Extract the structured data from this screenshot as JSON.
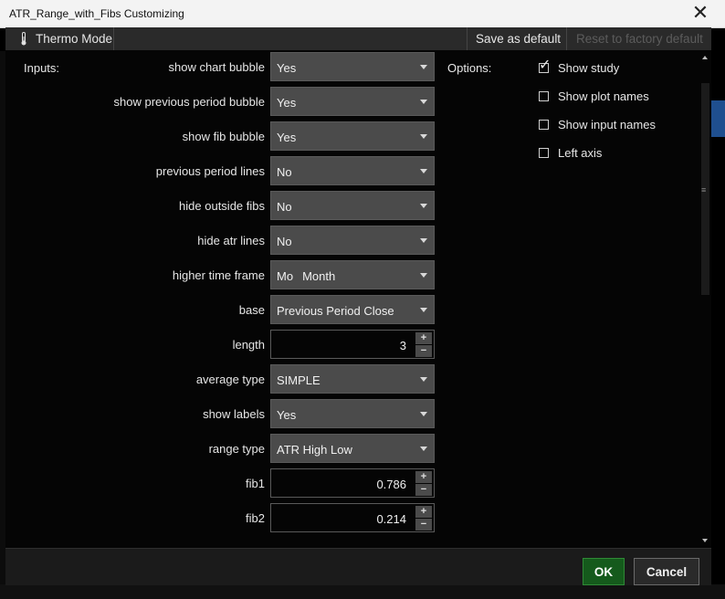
{
  "window": {
    "title": "ATR_Range_with_Fibs Customizing",
    "close_icon": "close-icon"
  },
  "toolbar": {
    "thermo_icon": "thermometer-icon",
    "thermo_label": "Thermo Mode",
    "save_default_label": "Save as default",
    "reset_default_label": "Reset to factory default"
  },
  "inputs": {
    "section_label": "Inputs:",
    "rows": [
      {
        "label": "show chart bubble",
        "type": "dropdown",
        "value": "Yes"
      },
      {
        "label": "show previous period bubble",
        "type": "dropdown",
        "value": "Yes"
      },
      {
        "label": "show fib bubble",
        "type": "dropdown",
        "value": "Yes"
      },
      {
        "label": "previous period lines",
        "type": "dropdown",
        "value": "No"
      },
      {
        "label": "hide outside fibs",
        "type": "dropdown",
        "value": "No"
      },
      {
        "label": "hide atr lines",
        "type": "dropdown",
        "value": "No"
      },
      {
        "label": "higher time frame",
        "type": "dropdown",
        "prefix": "Mo",
        "value": "Month"
      },
      {
        "label": "base",
        "type": "dropdown",
        "value": "Previous Period Close"
      },
      {
        "label": "length",
        "type": "number",
        "value": "3"
      },
      {
        "label": "average type",
        "type": "dropdown",
        "value": "SIMPLE"
      },
      {
        "label": "show labels",
        "type": "dropdown",
        "value": "Yes"
      },
      {
        "label": "range type",
        "type": "dropdown",
        "value": "ATR High Low"
      },
      {
        "label": "fib1",
        "type": "number",
        "value": "0.786"
      },
      {
        "label": "fib2",
        "type": "number",
        "value": "0.214"
      }
    ]
  },
  "options": {
    "section_label": "Options:",
    "items": [
      {
        "label": "Show study",
        "checked": true
      },
      {
        "label": "Show plot names",
        "checked": false
      },
      {
        "label": "Show input names",
        "checked": false
      },
      {
        "label": "Left axis",
        "checked": false
      }
    ]
  },
  "footer": {
    "ok_label": "OK",
    "cancel_label": "Cancel"
  },
  "colors": {
    "ok_button": "#155a1c",
    "dropdown_bg": "#4b4b4b",
    "dialog_bg": "#050505"
  }
}
